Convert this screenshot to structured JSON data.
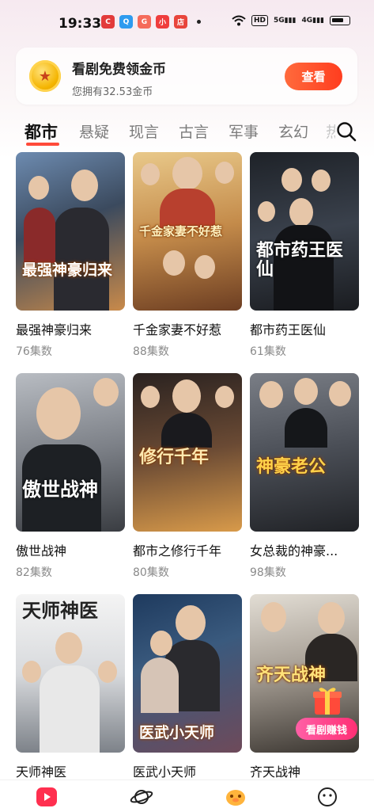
{
  "status_bar": {
    "time": "19:33",
    "notification_icons": [
      {
        "name": "app-c-icon",
        "color": "#e23b3b",
        "label": "C"
      },
      {
        "name": "qq-icon",
        "color": "#2e9bef",
        "label": "Q"
      },
      {
        "name": "game-icon",
        "color": "#f56b5b",
        "label": "G"
      },
      {
        "name": "app-red-icon",
        "color": "#ef3d3d",
        "label": "小"
      },
      {
        "name": "store-icon",
        "color": "#e8453c",
        "label": "店"
      }
    ],
    "hd_label": "HD",
    "signal_label_1": "5G",
    "signal_label_2": "4G"
  },
  "coin_banner": {
    "title": "看剧免费领金币",
    "subtitle": "您拥有32.53金币",
    "button_label": "查看"
  },
  "tabs": [
    {
      "label": "都市",
      "active": true
    },
    {
      "label": "悬疑",
      "active": false
    },
    {
      "label": "现言",
      "active": false
    },
    {
      "label": "古言",
      "active": false
    },
    {
      "label": "军事",
      "active": false
    },
    {
      "label": "玄幻",
      "active": false
    },
    {
      "label": "热",
      "active": false
    }
  ],
  "dramas": [
    {
      "name": "最强神豪归来",
      "episodes": "76集数",
      "poster_text": "最强神豪归来",
      "colors": [
        "#3b4a5e",
        "#c98a4a"
      ]
    },
    {
      "name": "千金家妻不好惹",
      "episodes": "88集数",
      "poster_text": "千金家妻不好惹",
      "colors": [
        "#d8b374",
        "#7a4a2a"
      ]
    },
    {
      "name": "都市药王医仙",
      "episodes": "61集数",
      "poster_text": "都市药王医仙",
      "colors": [
        "#2a2f38",
        "#555d68"
      ]
    },
    {
      "name": "傲世战神",
      "episodes": "82集数",
      "poster_text": "傲世战神",
      "colors": [
        "#8b8f96",
        "#2f3338"
      ]
    },
    {
      "name": "都市之修行千年",
      "episodes": "80集数",
      "poster_text": "修行千年",
      "colors": [
        "#4a3a30",
        "#c8863c"
      ]
    },
    {
      "name": "女总裁的神豪...",
      "episodes": "98集数",
      "poster_text": "神豪老公",
      "colors": [
        "#5c6068",
        "#2a2c30"
      ]
    },
    {
      "name": "天师神医",
      "episodes": "",
      "poster_text": "天师神医",
      "colors": [
        "#f2f2f2",
        "#9aa0a8"
      ]
    },
    {
      "name": "医武小天师",
      "episodes": "",
      "poster_text": "医武小天师",
      "colors": [
        "#2a4a6e",
        "#6e4a5a"
      ]
    },
    {
      "name": "齐天战神",
      "episodes": "",
      "poster_text": "齐天战神",
      "colors": [
        "#c9c3b8",
        "#3a3530"
      ]
    }
  ],
  "promo_badge": "看剧赚钱",
  "bottom_nav": [
    {
      "name": "nav-theater",
      "icon": "play-icon",
      "active": true
    },
    {
      "name": "nav-discover",
      "icon": "planet-icon",
      "active": false
    },
    {
      "name": "nav-welfare",
      "icon": "piggy-icon",
      "active": false
    },
    {
      "name": "nav-profile",
      "icon": "smile-icon",
      "active": false
    }
  ]
}
